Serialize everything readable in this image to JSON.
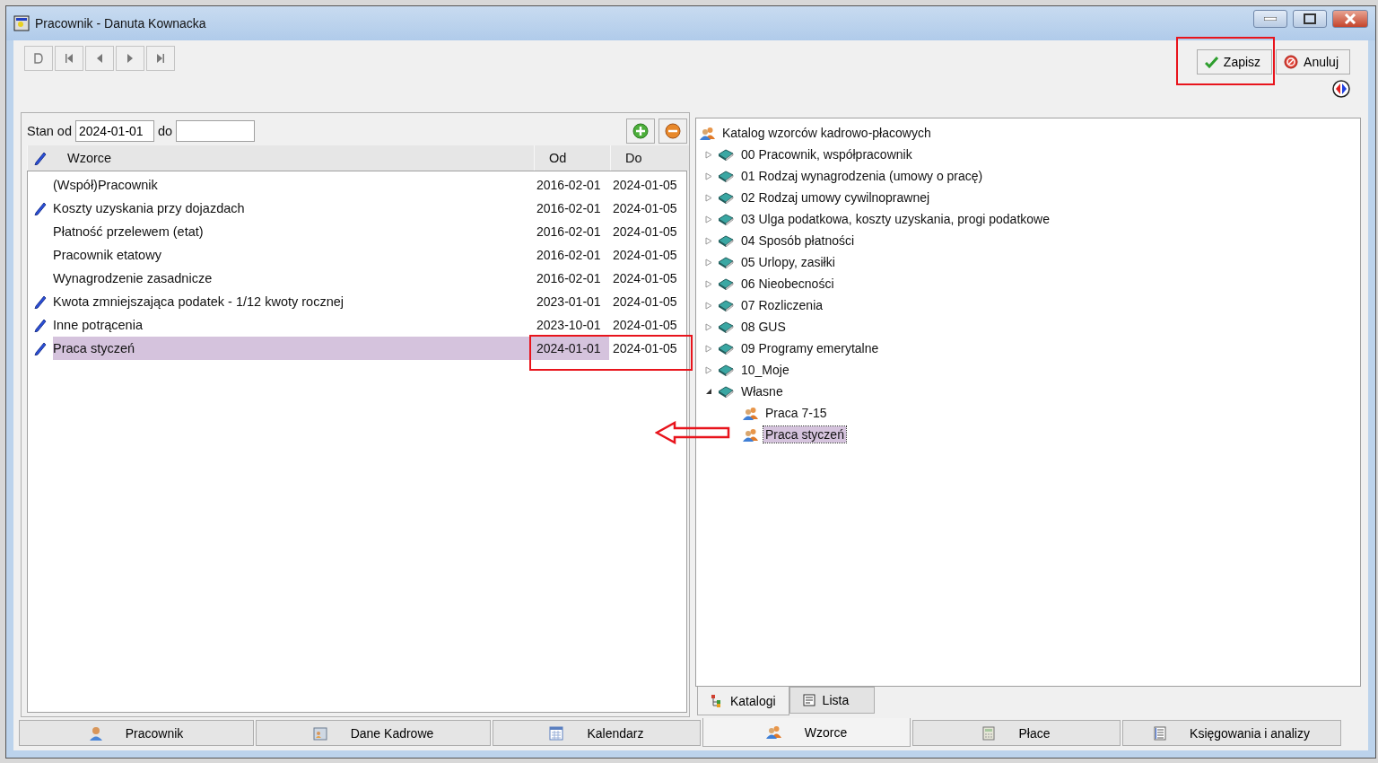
{
  "window": {
    "title": "Pracownik - Danuta Kownacka"
  },
  "actions": [
    {
      "label": "Zapisz",
      "kind": "save"
    },
    {
      "label": "Anuluj",
      "kind": "cancel"
    }
  ],
  "filter": {
    "from_label": "Stan od",
    "from": "2024-01-01",
    "to_label": "do"
  },
  "table": {
    "columns": [
      "Wzorce",
      "Od",
      "Do"
    ],
    "rows": [
      {
        "name": "(Współ)Pracownik",
        "from": "2016-02-01",
        "to": "2024-01-05",
        "edited": false,
        "selected": false
      },
      {
        "name": "Koszty uzyskania przy dojazdach",
        "from": "2016-02-01",
        "to": "2024-01-05",
        "edited": true,
        "selected": false
      },
      {
        "name": "Płatność przelewem (etat)",
        "from": "2016-02-01",
        "to": "2024-01-05",
        "edited": false,
        "selected": false
      },
      {
        "name": "Pracownik etatowy",
        "from": "2016-02-01",
        "to": "2024-01-05",
        "edited": false,
        "selected": false
      },
      {
        "name": "Wynagrodzenie zasadnicze",
        "from": "2016-02-01",
        "to": "2024-01-05",
        "edited": false,
        "selected": false
      },
      {
        "name": "Kwota zmniejszająca podatek - 1/12 kwoty rocznej",
        "from": "2023-01-01",
        "to": "2024-01-05",
        "edited": true,
        "selected": false
      },
      {
        "name": "Inne potrącenia",
        "from": "2023-10-01",
        "to": "2024-01-05",
        "edited": true,
        "selected": false
      },
      {
        "name": "Praca styczeń",
        "from": "2024-01-01",
        "to": "2024-01-05",
        "edited": true,
        "selected": true
      }
    ]
  },
  "tree": {
    "root": "Katalog wzorców kadrowo-płacowych",
    "items": [
      {
        "label": "00 Pracownik, współpracownik",
        "expanded": false
      },
      {
        "label": "01 Rodzaj wynagrodzenia (umowy o pracę)",
        "expanded": false
      },
      {
        "label": "02 Rodzaj umowy cywilnoprawnej",
        "expanded": false
      },
      {
        "label": "03 Ulga podatkowa, koszty uzyskania, progi podatkowe",
        "expanded": false
      },
      {
        "label": "04 Sposób płatności",
        "expanded": false
      },
      {
        "label": "05 Urlopy, zasiłki",
        "expanded": false
      },
      {
        "label": "06 Nieobecności",
        "expanded": false
      },
      {
        "label": "07 Rozliczenia",
        "expanded": false
      },
      {
        "label": "08 GUS",
        "expanded": false
      },
      {
        "label": "09 Programy emerytalne",
        "expanded": false
      },
      {
        "label": "10_Moje",
        "expanded": false
      },
      {
        "label": "Własne",
        "expanded": true,
        "children": [
          {
            "label": "Praca 7-15",
            "selected": false
          },
          {
            "label": "Praca styczeń",
            "selected": true
          }
        ]
      }
    ]
  },
  "panel_tabs": [
    {
      "label": "Katalogi",
      "selected": true
    },
    {
      "label": "Lista",
      "selected": false
    }
  ],
  "bottom_tabs": [
    {
      "label": "Pracownik",
      "selected": false
    },
    {
      "label": "Dane Kadrowe",
      "selected": false
    },
    {
      "label": "Kalendarz",
      "selected": false
    },
    {
      "label": "Wzorce",
      "selected": true
    },
    {
      "label": "Płace",
      "selected": false
    },
    {
      "label": "Księgowania i analizy",
      "selected": false
    }
  ]
}
